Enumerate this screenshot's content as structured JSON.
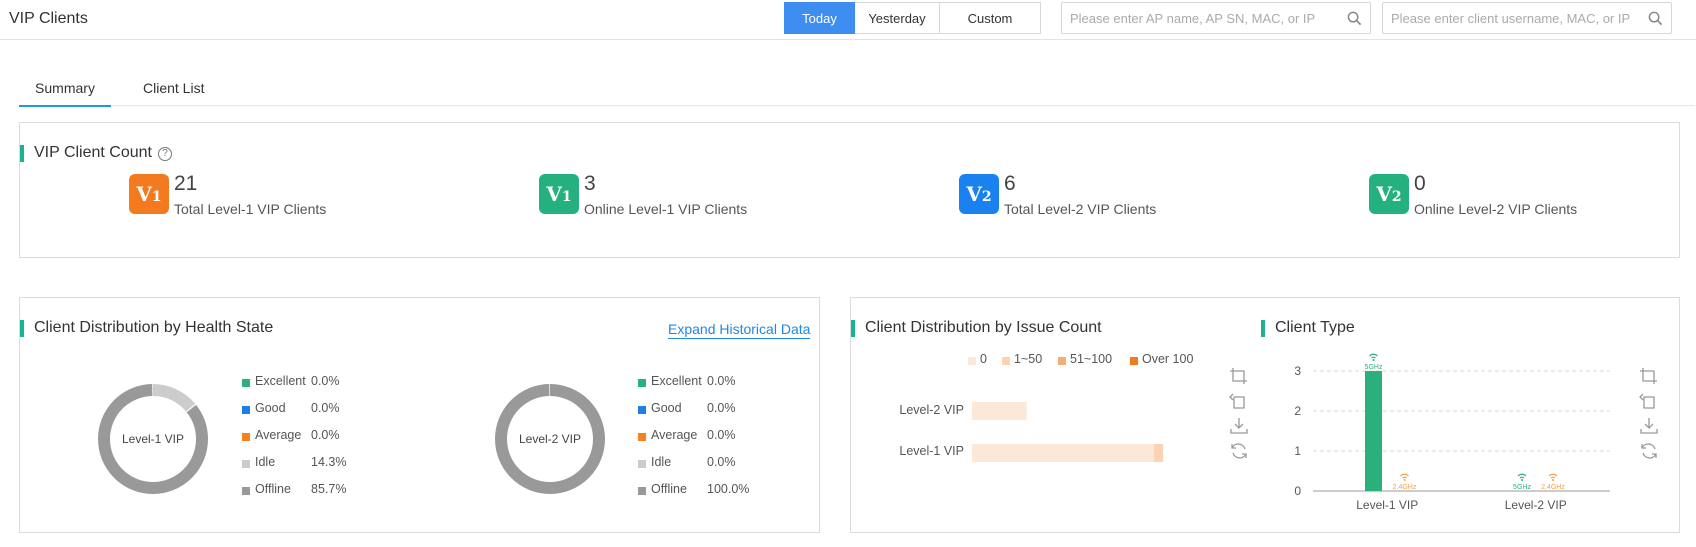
{
  "header": {
    "title": "VIP Clients",
    "date_buttons": [
      {
        "label": "Today",
        "active": true
      },
      {
        "label": "Yesterday",
        "active": false
      },
      {
        "label": "Custom",
        "active": false
      }
    ],
    "ap_search_placeholder": "Please enter AP name, AP SN, MAC, or IP",
    "client_search_placeholder": "Please enter client username, MAC, or IP"
  },
  "tabs": [
    {
      "label": "Summary",
      "active": true
    },
    {
      "label": "Client List",
      "active": false
    }
  ],
  "vip_count": {
    "title": "VIP Client Count",
    "help": "?",
    "cards": [
      {
        "badge": "V",
        "badge_sub": "1",
        "color": "#f37a1f",
        "count": "21",
        "label": "Total Level-1 VIP Clients"
      },
      {
        "badge": "V",
        "badge_sub": "1",
        "color": "#25b17f",
        "count": "3",
        "label": "Online Level-1 VIP Clients"
      },
      {
        "badge": "V",
        "badge_sub": "2",
        "color": "#1a82f0",
        "count": "6",
        "label": "Total Level-2 VIP Clients"
      },
      {
        "badge": "V",
        "badge_sub": "2",
        "color": "#25b17f",
        "count": "0",
        "label": "Online Level-2 VIP Clients"
      }
    ]
  },
  "health": {
    "title": "Client Distribution by Health State",
    "expand_link": "Expand Historical Data",
    "colors": {
      "Excellent": "#2bb07c",
      "Good": "#1e7fe6",
      "Average": "#f58220",
      "Idle": "#cccccc",
      "Offline": "#999999"
    },
    "donuts": [
      {
        "center_label": "Level-1 VIP",
        "legend": [
          {
            "name": "Excellent",
            "pct": "0.0%",
            "value": 0
          },
          {
            "name": "Good",
            "pct": "0.0%",
            "value": 0
          },
          {
            "name": "Average",
            "pct": "0.0%",
            "value": 0
          },
          {
            "name": "Idle",
            "pct": "14.3%",
            "value": 14.3
          },
          {
            "name": "Offline",
            "pct": "85.7%",
            "value": 85.7
          }
        ]
      },
      {
        "center_label": "Level-2 VIP",
        "legend": [
          {
            "name": "Excellent",
            "pct": "0.0%",
            "value": 0
          },
          {
            "name": "Good",
            "pct": "0.0%",
            "value": 0
          },
          {
            "name": "Average",
            "pct": "0.0%",
            "value": 0
          },
          {
            "name": "Idle",
            "pct": "0.0%",
            "value": 0
          },
          {
            "name": "Offline",
            "pct": "100.0%",
            "value": 100
          }
        ]
      }
    ]
  },
  "issue": {
    "title": "Client Distribution by Issue Count",
    "legend": [
      {
        "label": "0",
        "color": "#fde7d6"
      },
      {
        "label": "1~50",
        "color": "#fbd3b3"
      },
      {
        "label": "51~100",
        "color": "#f7ad79"
      },
      {
        "label": "Over 100",
        "color": "#f37a1f"
      }
    ],
    "chart_data": {
      "type": "bar",
      "orientation": "horizontal",
      "stacked": true,
      "categories": [
        "Level-2 VIP",
        "Level-1 VIP"
      ],
      "series": [
        {
          "name": "0",
          "values": [
            6,
            20
          ]
        },
        {
          "name": "1~50",
          "values": [
            0,
            1
          ]
        },
        {
          "name": "51~100",
          "values": [
            0,
            0
          ]
        },
        {
          "name": "Over 100",
          "values": [
            0,
            0
          ]
        }
      ]
    }
  },
  "client_type": {
    "title": "Client Type",
    "band_labels": {
      "5g": "5GHz",
      "2g": "2.4GHz"
    },
    "colors": {
      "5g": "#2bb07c",
      "2g": "#f5a04a"
    },
    "chart_data": {
      "type": "bar",
      "categories": [
        "Level-1 VIP",
        "Level-2 VIP"
      ],
      "yticks": [
        "0",
        "1",
        "2",
        "3"
      ],
      "ylim": [
        0,
        3
      ],
      "grid": true,
      "series": [
        {
          "name": "5GHz",
          "values": [
            3,
            0
          ]
        },
        {
          "name": "2.4GHz",
          "values": [
            0,
            0
          ]
        }
      ]
    }
  }
}
